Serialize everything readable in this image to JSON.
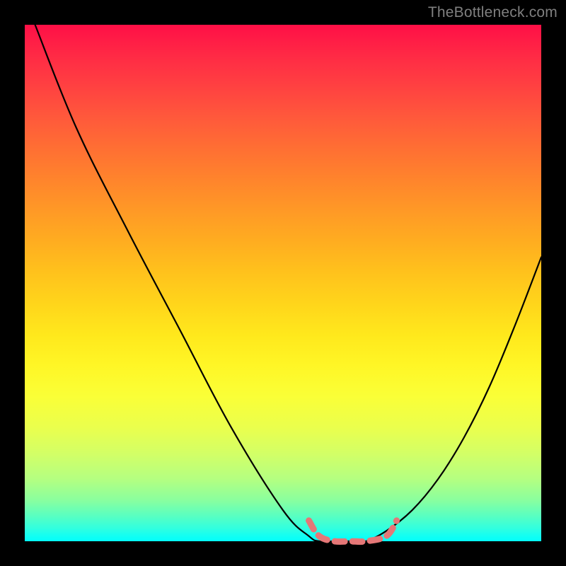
{
  "watermark": "TheBottleneck.com",
  "colors": {
    "frame": "#000000",
    "watermark": "#7f7f7f",
    "curve_main": "#000000",
    "curve_marker": "#e57777"
  },
  "chart_data": {
    "type": "line",
    "title": "",
    "xlabel": "",
    "ylabel": "",
    "xlim": [
      0,
      100
    ],
    "ylim": [
      0,
      100
    ],
    "series": [
      {
        "name": "bottleneck-curve",
        "x": [
          2,
          10,
          20,
          30,
          40,
          50,
          55,
          57,
          60,
          63,
          66,
          70,
          75,
          80,
          85,
          90,
          95,
          100
        ],
        "y": [
          100,
          80,
          60,
          41,
          22,
          6,
          1,
          0,
          0,
          0,
          0,
          2,
          6,
          12,
          20,
          30,
          42,
          55
        ]
      },
      {
        "name": "optimal-range-marker",
        "x": [
          55,
          57,
          60,
          63,
          66,
          70,
          72
        ],
        "y": [
          4,
          1,
          0,
          0,
          0,
          1,
          4
        ]
      }
    ],
    "annotations": []
  }
}
